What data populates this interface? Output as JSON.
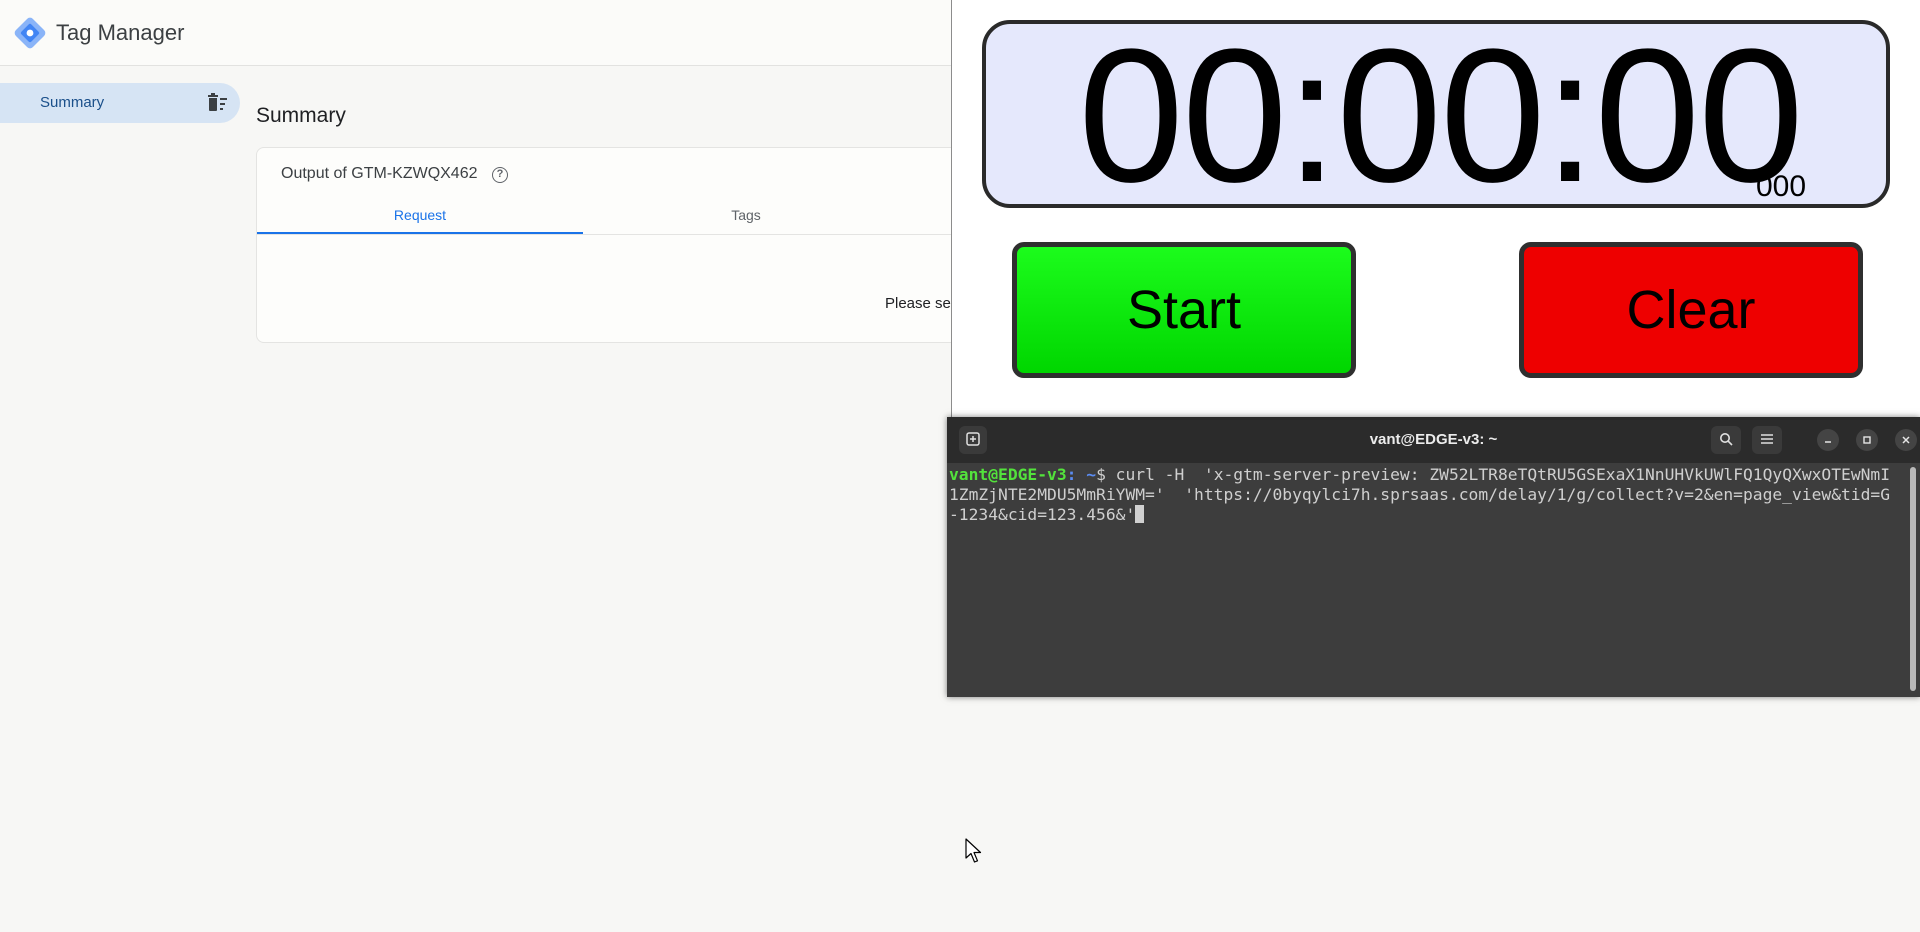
{
  "gtm": {
    "app_title": "Tag Manager",
    "nav": {
      "summary_label": "Summary"
    },
    "page_title": "Summary",
    "card": {
      "title": "Output of GTM-KZWQX462",
      "help_glyph": "?",
      "tabs": [
        {
          "label": "Request",
          "active": true
        },
        {
          "label": "Tags",
          "active": false
        }
      ],
      "empty_message": "Please sele"
    }
  },
  "stopwatch": {
    "time": "00:00:00",
    "milliseconds": "000",
    "start_label": "Start",
    "clear_label": "Clear",
    "colors": {
      "display_bg": "#e5e8fc",
      "start": "#00e600",
      "clear": "#ee0000"
    }
  },
  "terminal": {
    "title": "vant@EDGE-v3: ~",
    "prompt_user": "vant@EDGE-v3",
    "prompt_path": ": ~",
    "prompt_symbol": "$ ",
    "command": "curl -H  'x-gtm-server-preview: ZW52LTR8eTQtRU5GSExaX1NnUHVkUWlFQ1QyQXwxOTEwNmI1ZmZjNTE2MDU5MmRiYWM='  'https://0byqylci7h.sprsaas.com/delay/1/g/collect?v=2&en=page_view&tid=G-1234&cid=123.456&'",
    "icons": [
      "new-tab-icon",
      "search-icon",
      "hamburger-menu-icon",
      "minimize-icon",
      "maximize-icon",
      "close-icon"
    ],
    "colors": {
      "user": "#53e23c",
      "path": "#5b8cf2",
      "bg": "#3d3d3d"
    }
  }
}
